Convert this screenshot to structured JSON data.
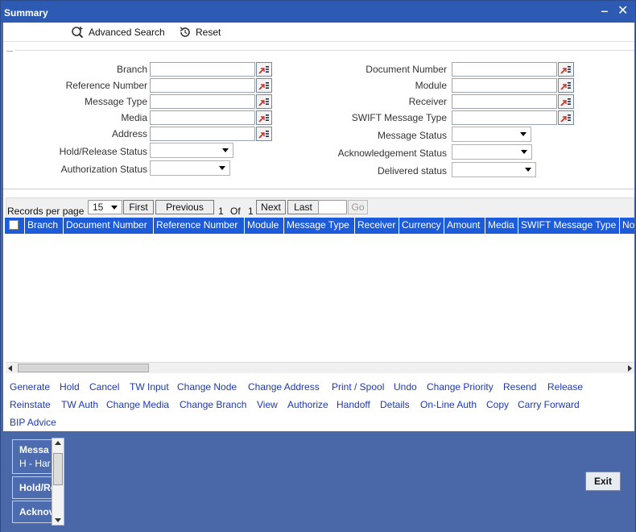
{
  "window": {
    "title": "Summary",
    "minimize_symbol": "‒",
    "close_symbol": "✕"
  },
  "toolbar": {
    "advanced_search_label": "Advanced Search",
    "reset_label": "Reset"
  },
  "form": {
    "left": {
      "branch": "Branch",
      "reference_number": "Reference Number",
      "message_type": "Message Type",
      "media": "Media",
      "address": "Address",
      "hold_release_status": "Hold/Release Status",
      "authorization_status": "Authorization Status"
    },
    "right": {
      "document_number": "Document Number",
      "module": "Module",
      "receiver": "Receiver",
      "swift_message_type": "SWIFT Message Type",
      "message_status": "Message Status",
      "acknowledgement_status": "Acknowledgement Status",
      "delivered_status": "Delivered status"
    }
  },
  "pager": {
    "records_per_page_label": "Records per page",
    "records_per_page_value": "15",
    "first": "First",
    "previous": "Previous",
    "current_page": "1",
    "of_label": "Of",
    "total_pages": "1",
    "next": "Next",
    "last": "Last",
    "go": "Go"
  },
  "grid": {
    "columns": [
      "Branch",
      "Document Number",
      "Reference Number",
      "Module",
      "Message Type",
      "Receiver",
      "Currency",
      "Amount",
      "Media",
      "SWIFT Message Type",
      "No"
    ]
  },
  "actions": {
    "row1": [
      "Generate",
      "Hold",
      "Cancel",
      "TW Input",
      "Change Node",
      "Change Address",
      "Print / Spool",
      "Undo",
      "Change Priority",
      "Resend",
      "Release"
    ],
    "row2": [
      "Reinstate",
      "TW Auth",
      "Change Media",
      "Change Branch",
      "View",
      "Authorize",
      "Handoff",
      "Details",
      "On-Line Auth",
      "Copy",
      "Carry Forward"
    ],
    "row3": [
      "BIP Advice"
    ]
  },
  "audit": {
    "box1_title": "Messa",
    "box1_value": "H - Har",
    "box2_title": "Hold/Re",
    "box3_title": "Acknov"
  },
  "footer": {
    "exit_label": "Exit"
  },
  "colors": {
    "titlebar": "#2d5bb3",
    "grid_header": "#1c5bd9",
    "footer": "#4a67a8",
    "action_link": "#1e3aa8"
  }
}
